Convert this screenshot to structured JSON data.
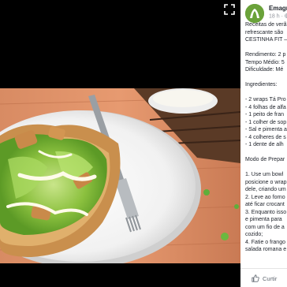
{
  "post": {
    "page_name": "Emagrec",
    "timestamp": "18 h",
    "privacy_icon": "globe-icon",
    "caption_lines": [
      "Receitas de verã",
      "refrescante são",
      "CESTINHA FIT –"
    ],
    "recipe_meta": [
      "Rendimento: 2 p",
      "Tempo Médio: 5",
      "Dificuldade: Mé"
    ],
    "ingredients_title": "Ingredientes:",
    "ingredients": [
      "- 2 wraps Tá Pro",
      "- 4 folhas de alfa",
      "- 1 peito de fran",
      "- 1 colher de sop",
      "- Sal e pimenta a",
      "- 4 colheres de s",
      "- 1 dente de alh"
    ],
    "method_title": "Modo de Prepar",
    "method_lines": [
      "1. Use um bowl",
      "posicione o wrap",
      "dele, criando um",
      "2. Leve ao forno",
      "até ficar crocant",
      "3. Enquanto isso",
      "e pimenta para",
      "com um fio de a",
      "cozido;",
      "4. Fatie o frango",
      "salada romana e"
    ]
  },
  "actions": {
    "like_label": "Curtir"
  },
  "colors": {
    "brand_green": "#6aa23a",
    "link_blue": "#365899",
    "text": "#1d2129",
    "meta": "#90949c"
  }
}
